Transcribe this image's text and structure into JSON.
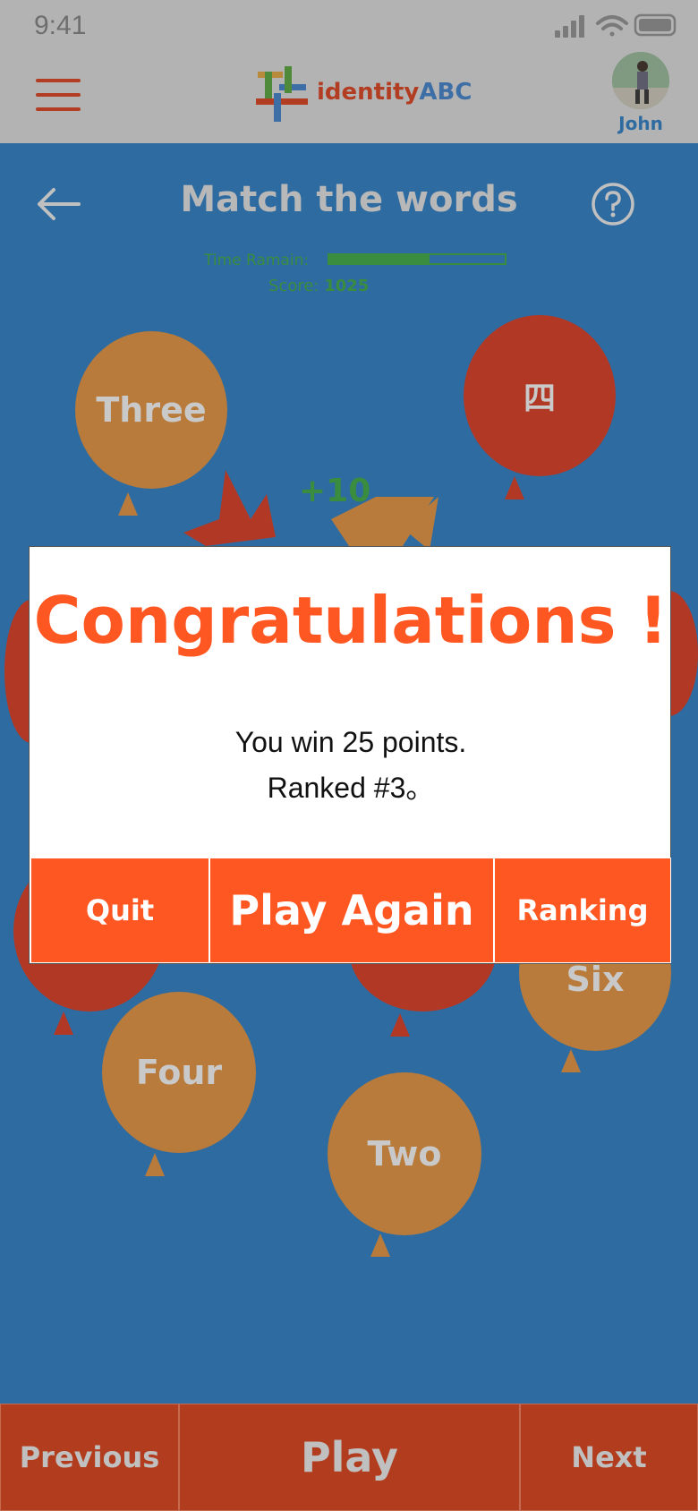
{
  "status_bar": {
    "time": "9:41"
  },
  "header": {
    "logo_text_main": "identity",
    "logo_text_accent": "ABC",
    "user_name": "John"
  },
  "game": {
    "title": "Match the words",
    "time_label": "Time Ramain:",
    "time_remaining_fraction": 0.57,
    "score_label": "Score:",
    "score_value": "1025",
    "bonus": "+10",
    "balloons": {
      "three": "Three",
      "si": "四",
      "six": "Six",
      "four": "Four",
      "two": "Two"
    }
  },
  "dialog": {
    "title": "Congratulations !",
    "message_line1": "You win 25 points.",
    "message_line2": "Ranked #3。",
    "quit_label": "Quit",
    "play_again_label": "Play Again",
    "ranking_label": "Ranking"
  },
  "bottom_nav": {
    "previous_label": "Previous",
    "play_label": "Play",
    "next_label": "Next"
  },
  "colors": {
    "background": "#2e6ba1",
    "accent": "#ff5722",
    "header_bg": "#b3b3b3",
    "orange_balloon": "#b87b3c",
    "red_balloon": "#b23826",
    "timer_green": "#3a8c3f"
  }
}
